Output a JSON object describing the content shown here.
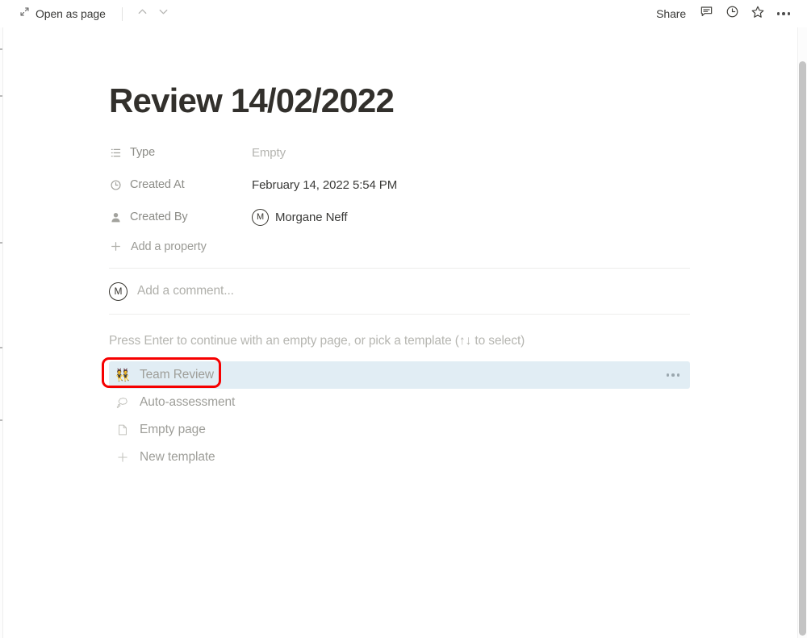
{
  "topbar": {
    "open_as_page_label": "Open as page",
    "open_as_page_icon": "expand-diagonal-icon",
    "prev_icon": "chevron-up-icon",
    "next_icon": "chevron-down-icon",
    "share_label": "Share",
    "comment_icon": "comment-bubble-icon",
    "history_icon": "clock-history-icon",
    "favorite_icon": "star-icon",
    "more_icon": "ellipsis-icon"
  },
  "page": {
    "title": "Review 14/02/2022"
  },
  "properties": {
    "rows": [
      {
        "icon": "list-icon",
        "label": "Type",
        "value": "Empty",
        "is_empty": true
      },
      {
        "icon": "clock-icon",
        "label": "Created At",
        "value": "February 14, 2022 5:54 PM",
        "is_empty": false
      },
      {
        "icon": "person-icon",
        "label": "Created By",
        "value": "Morgane Neff",
        "avatar_initial": "M",
        "is_empty": false
      }
    ],
    "add_property_label": "Add a property",
    "add_property_icon": "plus-icon"
  },
  "comment": {
    "avatar_initial": "M",
    "placeholder": "Add a comment..."
  },
  "template_picker": {
    "hint": "Press Enter to continue with an empty page, or pick a template (↑↓ to select)",
    "options": [
      {
        "label": "Team Review",
        "icon": "dancers-emoji",
        "emoji": "👯",
        "selected": true,
        "has_more": true,
        "more_icon": "ellipsis-icon"
      },
      {
        "label": "Auto-assessment",
        "icon": "thought-bubble-icon",
        "selected": false,
        "has_more": false
      },
      {
        "label": "Empty page",
        "icon": "page-icon",
        "selected": false,
        "has_more": false
      },
      {
        "label": "New template",
        "icon": "plus-icon",
        "selected": false,
        "has_more": false
      }
    ]
  },
  "annotation": {
    "target": "Team Review",
    "color": "#f60000"
  },
  "colors": {
    "selected_row_background": "#e1edf4",
    "title_text": "#32302c",
    "muted_text": "#9e9e99",
    "divider": "#ededec",
    "scrollbar_thumb": "#c4c4c4"
  },
  "scrollbar": {
    "orientation": "vertical",
    "name": "page-scrollbar"
  }
}
